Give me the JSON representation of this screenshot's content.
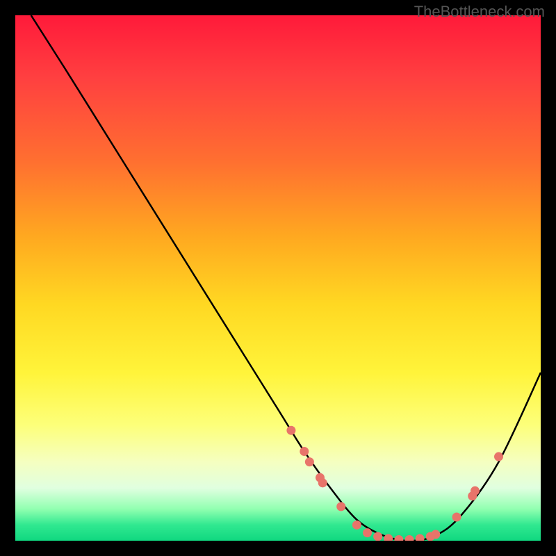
{
  "watermark": "TheBottleneck.com",
  "chart_data": {
    "type": "line",
    "title": "",
    "xlabel": "",
    "ylabel": "",
    "xlim": [
      0,
      100
    ],
    "ylim": [
      0,
      100
    ],
    "series": [
      {
        "name": "curve",
        "x": [
          3,
          10,
          20,
          30,
          40,
          50,
          55,
          60,
          65,
          70,
          75,
          80,
          85,
          92,
          100
        ],
        "y": [
          100,
          89,
          73,
          57,
          41,
          25,
          17,
          10,
          4,
          1,
          0,
          1,
          5,
          15,
          32
        ]
      }
    ],
    "markers": [
      {
        "x": 52.5,
        "y": 21
      },
      {
        "x": 55,
        "y": 17
      },
      {
        "x": 56,
        "y": 15
      },
      {
        "x": 58,
        "y": 12
      },
      {
        "x": 58.5,
        "y": 11
      },
      {
        "x": 62,
        "y": 6.5
      },
      {
        "x": 65,
        "y": 3
      },
      {
        "x": 67,
        "y": 1.5
      },
      {
        "x": 69,
        "y": 0.8
      },
      {
        "x": 71,
        "y": 0.4
      },
      {
        "x": 73,
        "y": 0.2
      },
      {
        "x": 75,
        "y": 0.2
      },
      {
        "x": 77,
        "y": 0.4
      },
      {
        "x": 79,
        "y": 0.8
      },
      {
        "x": 80,
        "y": 1.2
      },
      {
        "x": 84,
        "y": 4.5
      },
      {
        "x": 87,
        "y": 8.5
      },
      {
        "x": 87.5,
        "y": 9.5
      },
      {
        "x": 92,
        "y": 16
      }
    ],
    "colors": {
      "curve": "#000000",
      "marker": "#e8746a"
    }
  }
}
